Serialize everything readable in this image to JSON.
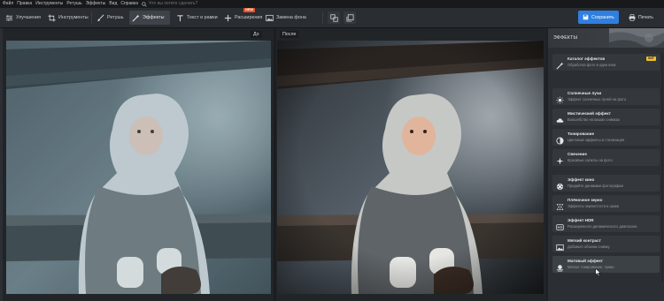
{
  "menu": {
    "items": [
      "Файл",
      "Правка",
      "Инструменты",
      "Ретушь",
      "Эффекты",
      "Вид",
      "Справка"
    ],
    "search_placeholder": "Что вы хотите сделать?"
  },
  "toolbar": {
    "enhance": "Улучшения",
    "tools": "Инструменты",
    "retouch": "Ретушь",
    "effects": "Эффекты",
    "text": "Текст и рамки",
    "extras": "Расширения",
    "extras_badge": "NEW",
    "replace_bg": "Замена фона",
    "save": "Сохранить",
    "print": "Печать"
  },
  "canvas": {
    "before_label": "До",
    "after_label": "После"
  },
  "panel": {
    "title": "ЭФФЕКТЫ",
    "items": [
      {
        "title": "Каталог эффектов",
        "subtitle": "Обработка фото в один клик",
        "badge": "ХИТ",
        "icon": "magic-wand-icon"
      },
      {
        "title": "Солнечные лучи",
        "subtitle": "Эффект солнечных лучей на фото",
        "icon": "sun-icon"
      },
      {
        "title": "Мистический эффект",
        "subtitle": "Волшебство на ваших снимках",
        "icon": "cloud-icon"
      },
      {
        "title": "Тонирование",
        "subtitle": "Цветовые эффекты и стилизация",
        "icon": "contrast-circle-icon"
      },
      {
        "title": "Свечение",
        "subtitle": "Красивые салюты на фото",
        "icon": "sparkle-icon"
      },
      {
        "title": "Эффект кино",
        "subtitle": "Придайте динамики фотографии",
        "icon": "film-reel-icon"
      },
      {
        "title": "Плёночное зерно",
        "subtitle": "Эффекты зернистости и шума",
        "icon": "grain-icon"
      },
      {
        "title": "Эффект HDR",
        "subtitle": "Расширенного динамического диапазона",
        "icon": "hdr-icon"
      },
      {
        "title": "Мягкий контраст",
        "subtitle": "Добавьте объема снимку",
        "icon": "landscape-icon"
      },
      {
        "title": "Матовый эффект",
        "subtitle": "Мягкое тонирование, туман",
        "icon": "fog-icon"
      }
    ]
  },
  "colors": {
    "accent": "#2f7fe0",
    "badge_new": "#e3562b",
    "badge_hit": "#f0c02c",
    "panel_bg": "#2b2e32"
  }
}
